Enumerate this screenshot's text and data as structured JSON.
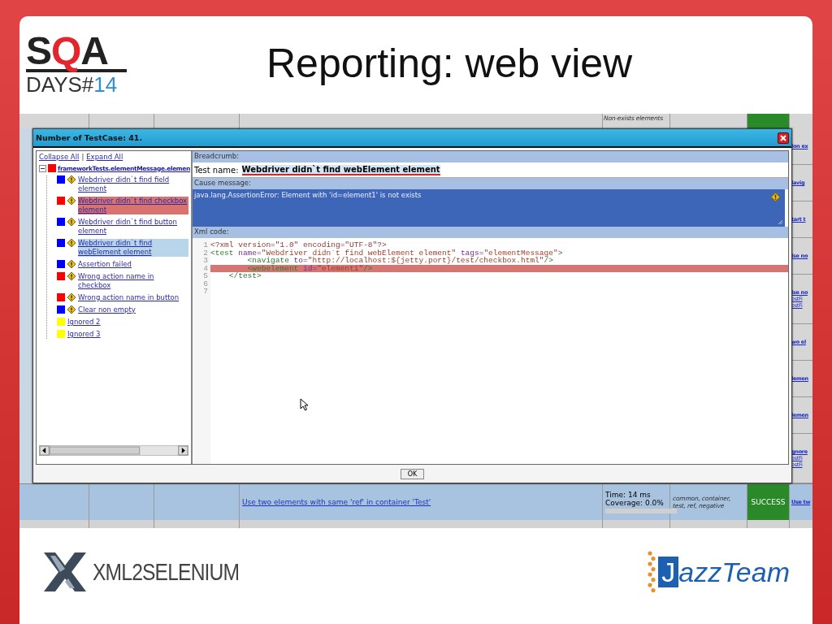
{
  "slide": {
    "logo": {
      "parts": [
        {
          "text": "S",
          "color": "#222222"
        },
        {
          "text": "Q",
          "color": "#e3262b"
        },
        {
          "text": "A",
          "color": "#222222"
        }
      ],
      "subtitle_parts": [
        {
          "text": "DAYS#",
          "color": "#333333"
        },
        {
          "text": "14",
          "color": "#2b8fd6"
        }
      ]
    },
    "title": "Reporting: web view"
  },
  "report_table": {
    "top_row": {
      "column_5": "Non-exists elements"
    },
    "right_column": [
      [
        "lon ex"
      ],
      [
        "lavig"
      ],
      [
        "tart t"
      ],
      [
        "lse no"
      ],
      [
        "lse no",
        "estFi",
        "estFi"
      ],
      [
        "wo el"
      ],
      [
        "lemen"
      ],
      [
        "lemen"
      ],
      [
        "gnore",
        "estFi",
        "estFi"
      ]
    ],
    "bottom_row": {
      "test_link": "Use two elements with same 'ref' in container 'Test'",
      "time": "Time: 14 ms",
      "coverage": "Coverage: 0.0%",
      "level": 0,
      "tags": "common, container, test, ref, negative",
      "status": "SUCCESS",
      "next_link": "Use tw"
    }
  },
  "dialog": {
    "title": "Number of TestCase: 41.",
    "tree": {
      "links": [
        "Collapse All",
        "Expand All"
      ],
      "separator": "|",
      "root": {
        "label": "frameworkTests.elementMessage.elemen",
        "color": "#ff0000",
        "expanded": true,
        "children": [
          {
            "label": "Webdriver didn`t find field element",
            "color": "#0000ff",
            "kind": "test",
            "selected": false,
            "highlighted": false
          },
          {
            "label": "Webdriver didn`t find checkbox element",
            "color": "#ff0000",
            "kind": "test",
            "selected": false,
            "highlighted": true
          },
          {
            "label": "Webdriver didn`t find button element",
            "color": "#0000ff",
            "kind": "test",
            "selected": false,
            "highlighted": false
          },
          {
            "label": "Webdriver didn`t find webElement element",
            "color": "#0000ff",
            "kind": "test",
            "selected": true,
            "highlighted": false
          },
          {
            "label": "Assertion failed",
            "color": "#0000ff",
            "kind": "test",
            "selected": false,
            "highlighted": false
          },
          {
            "label": "Wrong action name in checkbox",
            "color": "#ff0000",
            "kind": "test",
            "selected": false,
            "highlighted": false
          },
          {
            "label": "Wrong action name in button",
            "color": "#ff0000",
            "kind": "test",
            "selected": false,
            "highlighted": false
          },
          {
            "label": "Clear non empty",
            "color": "#0000ff",
            "kind": "test",
            "selected": false,
            "highlighted": false
          },
          {
            "label": "Ignored 2",
            "color": "#ffff00",
            "kind": "ignored",
            "selected": false,
            "highlighted": false
          },
          {
            "label": "Ignored 3",
            "color": "#ffff00",
            "kind": "ignored",
            "selected": false,
            "highlighted": false
          }
        ]
      }
    },
    "breadcrumb_label": "Breadcrumb:",
    "test_name_label": "Test name:",
    "test_name": "Webdriver didn`t find webElement element",
    "cause_label": "Cause message:",
    "cause_message": "java.lang.AssertionError: Element with 'id=element1' is not exists",
    "xml_label": "Xml code:",
    "code_lines": [
      {
        "number": "1",
        "highlighted": false,
        "tokens": [
          {
            "kind": "pi",
            "text": "<?xml version=\"1.0\" encoding=\"UTF-8\"?>"
          }
        ]
      },
      {
        "number": "2",
        "highlighted": false,
        "tokens": [
          {
            "kind": "tag",
            "text": "<test"
          },
          {
            "kind": "attr",
            "text": " name="
          },
          {
            "kind": "value",
            "text": "\"Webdriver didn`t find webElement element\""
          },
          {
            "kind": "attr",
            "text": " tags="
          },
          {
            "kind": "value",
            "text": "\"elementMessage\""
          },
          {
            "kind": "tag",
            "text": ">"
          }
        ]
      },
      {
        "number": "3",
        "highlighted": false,
        "tokens": [
          {
            "kind": "tag",
            "text": "        <navigate"
          },
          {
            "kind": "attr",
            "text": " to="
          },
          {
            "kind": "value",
            "text": "\"http://localhost:${jetty.port}/test/checkbox.html\""
          },
          {
            "kind": "tag",
            "text": "/>"
          }
        ]
      },
      {
        "number": "4",
        "highlighted": true,
        "tokens": [
          {
            "kind": "tag",
            "text": "        <webelement"
          },
          {
            "kind": "attr",
            "text": " id="
          },
          {
            "kind": "value",
            "text": "\"element1\""
          },
          {
            "kind": "tag",
            "text": "/>"
          }
        ]
      },
      {
        "number": "5",
        "highlighted": false,
        "tokens": [
          {
            "kind": "tag",
            "text": "    </test>"
          }
        ]
      },
      {
        "number": "6",
        "highlighted": false
      },
      {
        "number": "7",
        "highlighted": false
      }
    ],
    "ok_button": "OK"
  },
  "footer": {
    "left_logo": "XML2SELENIUM",
    "right_logo_parts": [
      {
        "kind": "boxed",
        "text": "J"
      },
      {
        "kind": "plain",
        "text": "azzTeam"
      }
    ]
  }
}
